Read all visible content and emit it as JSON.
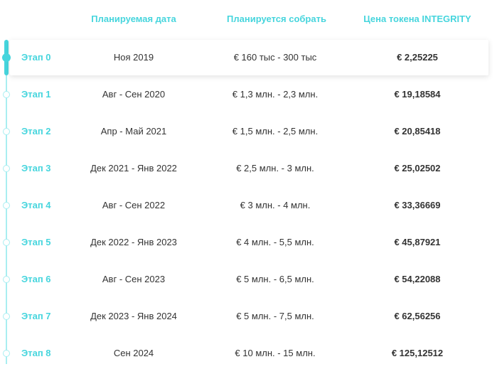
{
  "header": {
    "date_label": "Планируемая дата",
    "raise_label": "Планируется собрать",
    "price_label": "Цена токена INTEGRITY"
  },
  "colors": {
    "accent": "#46d5dd",
    "timeline_light": "#a9eef1",
    "text": "#333333"
  },
  "stages": [
    {
      "stage": "Этап 0",
      "date": "Ноя 2019",
      "raise": "€ 160 тыс - 300 тыс",
      "price": "€ 2,25225",
      "active": true
    },
    {
      "stage": "Этап 1",
      "date": "Авг - Сен 2020",
      "raise": "€ 1,3 млн. - 2,3 млн.",
      "price": "€ 19,18584",
      "active": false
    },
    {
      "stage": "Этап 2",
      "date": "Апр - Май 2021",
      "raise": "€ 1,5 млн. - 2,5 млн.",
      "price": "€ 20,85418",
      "active": false
    },
    {
      "stage": "Этап 3",
      "date": "Дек 2021 - Янв 2022",
      "raise": "€ 2,5 млн. - 3 млн.",
      "price": "€ 25,02502",
      "active": false
    },
    {
      "stage": "Этап 4",
      "date": "Авг - Сен 2022",
      "raise": "€ 3 млн. - 4 млн.",
      "price": "€ 33,36669",
      "active": false
    },
    {
      "stage": "Этап 5",
      "date": "Дек 2022 - Янв 2023",
      "raise": "€ 4 млн. - 5,5 млн.",
      "price": "€ 45,87921",
      "active": false
    },
    {
      "stage": "Этап 6",
      "date": "Авг - Сен 2023",
      "raise": "€ 5 млн. - 6,5 млн.",
      "price": "€ 54,22088",
      "active": false
    },
    {
      "stage": "Этап 7",
      "date": "Дек 2023 - Янв 2024",
      "raise": "€ 5 млн. - 7,5 млн.",
      "price": "€ 62,56256",
      "active": false
    },
    {
      "stage": "Этап 8",
      "date": "Сен 2024",
      "raise": "€ 10 млн. - 15 млн.",
      "price": "€ 125,12512",
      "active": false
    }
  ]
}
